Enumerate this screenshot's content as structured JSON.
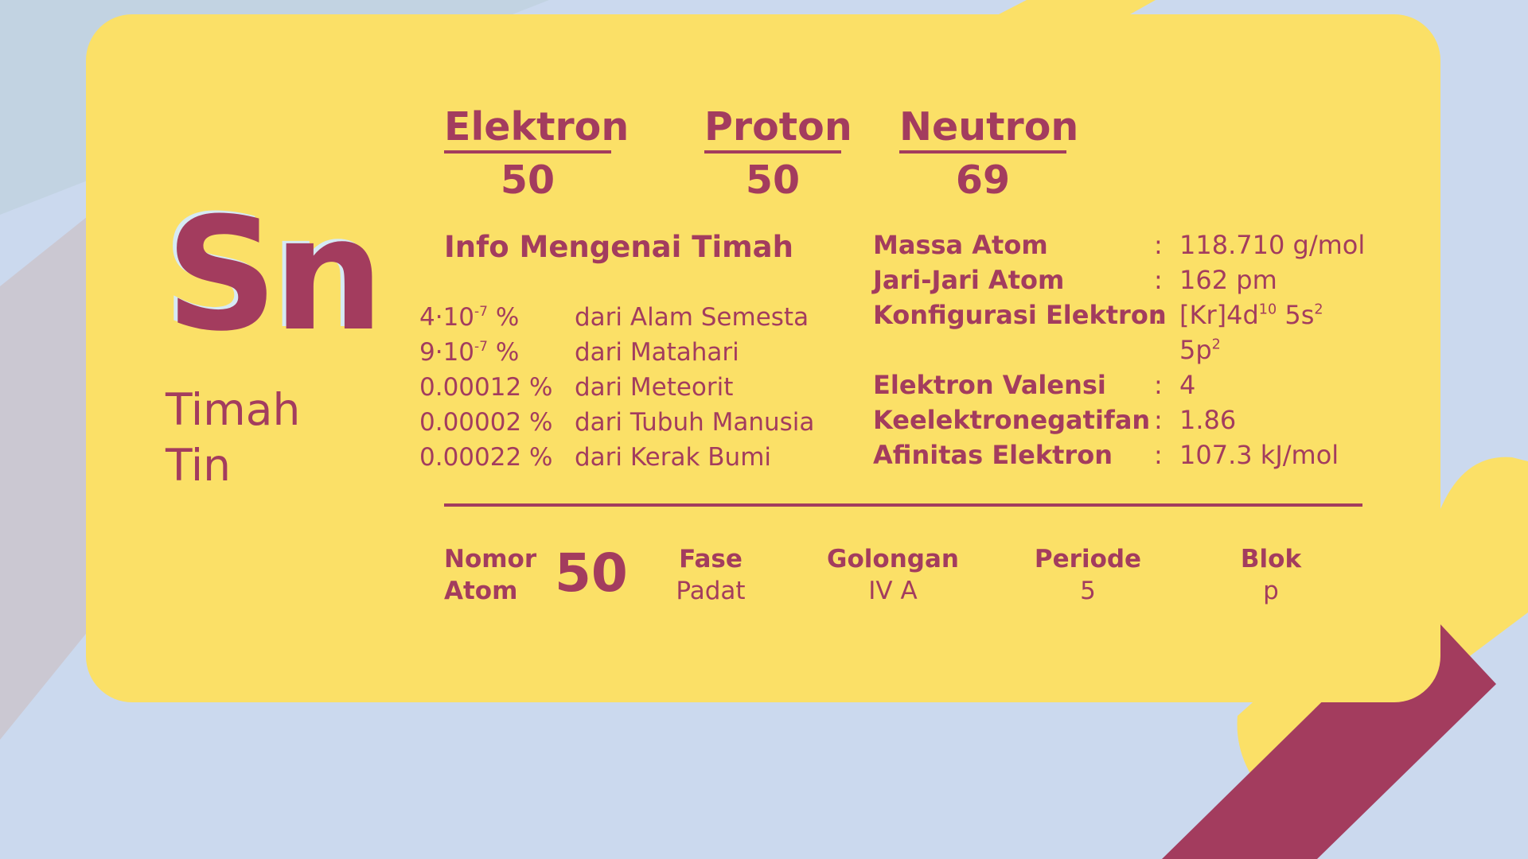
{
  "colors": {
    "background": "#cbd9ee",
    "card": "#fbe067",
    "text": "#a33c5e",
    "symbol_shadow": "#d6eaf4",
    "stripe_light": "#c2d3e2",
    "stripe_mid": "#cbc8d2",
    "decoration_yellow": "#fbe067",
    "decoration_maroon": "#a33c5e"
  },
  "element": {
    "symbol": "Sn",
    "name_id": "Timah",
    "name_en": "Tin"
  },
  "particles": [
    {
      "label": "Elektron",
      "value": "50"
    },
    {
      "label": "Proton",
      "value": "50"
    },
    {
      "label": "Neutron",
      "value": "69"
    }
  ],
  "info": {
    "title": "Info Mengenai Timah",
    "abundance": [
      {
        "base": "4·10",
        "exp": "-7",
        "unit": " %",
        "source": "dari Alam Semesta"
      },
      {
        "base": "9·10",
        "exp": "-7",
        "unit": " %",
        "source": "dari Matahari"
      },
      {
        "base": "0.00012 %",
        "exp": "",
        "unit": "",
        "source": "dari Meteorit"
      },
      {
        "base": "0.00002 %",
        "exp": "",
        "unit": "",
        "source": "dari Tubuh Manusia"
      },
      {
        "base": "0.00022 %",
        "exp": "",
        "unit": "",
        "source": "dari Kerak Bumi"
      }
    ]
  },
  "properties": {
    "colon": ":",
    "atomic_mass": {
      "label": "Massa Atom",
      "value": "118.710 g/mol"
    },
    "atomic_radius": {
      "label": "Jari-Jari Atom",
      "value": "162 pm"
    },
    "configuration": {
      "label": "Konfigurasi Elektron",
      "p1": "[Kr]4d",
      "s1": "10",
      "p2": " 5s",
      "s2": "2",
      "p3": "5p",
      "s3": "2"
    },
    "valence": {
      "label": "Elektron Valensi",
      "value": "4"
    },
    "electronegativity": {
      "label": "Keelektronegatifan",
      "value": "1.86"
    },
    "electron_affinity": {
      "label": "Afinitas Elektron",
      "value": "107.3 kJ/mol"
    }
  },
  "footer": {
    "atomic_number_label_1": "Nomor",
    "atomic_number_label_2": "Atom",
    "atomic_number": "50",
    "phase_label": "Fase",
    "phase": "Padat",
    "group_label": "Golongan",
    "group": "IV A",
    "period_label": "Periode",
    "period": "5",
    "block_label": "Blok",
    "block": "p"
  }
}
